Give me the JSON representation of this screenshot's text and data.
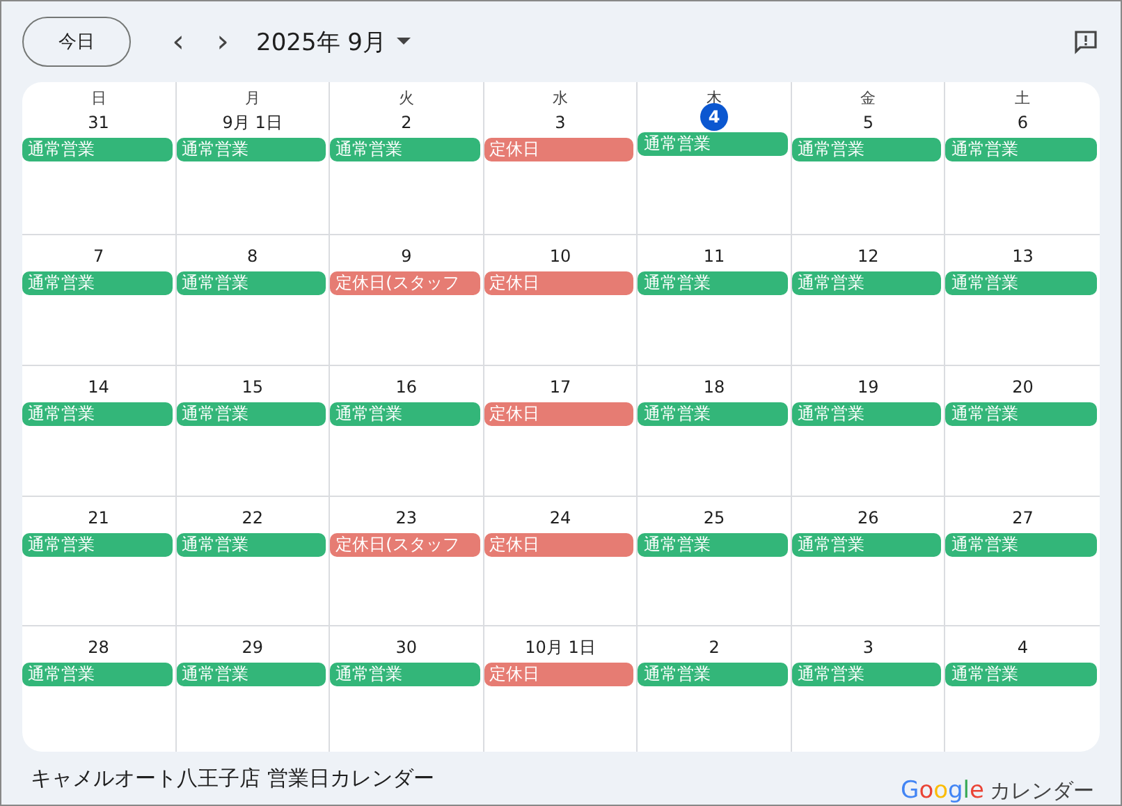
{
  "toolbar": {
    "today_button": "今日",
    "prev": "‹",
    "next": "›",
    "month": "2025年 9月"
  },
  "weekdays": [
    "日",
    "月",
    "火",
    "水",
    "木",
    "金",
    "土"
  ],
  "weeks": [
    [
      {
        "date": "31",
        "today": false,
        "event": {
          "kind": "open",
          "title": "通常営業"
        }
      },
      {
        "date": "9月 1日",
        "today": false,
        "event": {
          "kind": "open",
          "title": "通常営業"
        }
      },
      {
        "date": "2",
        "today": false,
        "event": {
          "kind": "open",
          "title": "通常営業"
        }
      },
      {
        "date": "3",
        "today": false,
        "event": {
          "kind": "closed",
          "title": "定休日"
        }
      },
      {
        "date": "4",
        "today": true,
        "event": {
          "kind": "open",
          "title": "通常営業"
        }
      },
      {
        "date": "5",
        "today": false,
        "event": {
          "kind": "open",
          "title": "通常営業"
        }
      },
      {
        "date": "6",
        "today": false,
        "event": {
          "kind": "open",
          "title": "通常営業"
        }
      }
    ],
    [
      {
        "date": "7",
        "today": false,
        "event": {
          "kind": "open",
          "title": "通常営業"
        }
      },
      {
        "date": "8",
        "today": false,
        "event": {
          "kind": "open",
          "title": "通常営業"
        }
      },
      {
        "date": "9",
        "today": false,
        "event": {
          "kind": "closed",
          "title": "定休日(スタッフ"
        }
      },
      {
        "date": "10",
        "today": false,
        "event": {
          "kind": "closed",
          "title": "定休日"
        }
      },
      {
        "date": "11",
        "today": false,
        "event": {
          "kind": "open",
          "title": "通常営業"
        }
      },
      {
        "date": "12",
        "today": false,
        "event": {
          "kind": "open",
          "title": "通常営業"
        }
      },
      {
        "date": "13",
        "today": false,
        "event": {
          "kind": "open",
          "title": "通常営業"
        }
      }
    ],
    [
      {
        "date": "14",
        "today": false,
        "event": {
          "kind": "open",
          "title": "通常営業"
        }
      },
      {
        "date": "15",
        "today": false,
        "event": {
          "kind": "open",
          "title": "通常営業"
        }
      },
      {
        "date": "16",
        "today": false,
        "event": {
          "kind": "open",
          "title": "通常営業"
        }
      },
      {
        "date": "17",
        "today": false,
        "event": {
          "kind": "closed",
          "title": "定休日"
        }
      },
      {
        "date": "18",
        "today": false,
        "event": {
          "kind": "open",
          "title": "通常営業"
        }
      },
      {
        "date": "19",
        "today": false,
        "event": {
          "kind": "open",
          "title": "通常営業"
        }
      },
      {
        "date": "20",
        "today": false,
        "event": {
          "kind": "open",
          "title": "通常営業"
        }
      }
    ],
    [
      {
        "date": "21",
        "today": false,
        "event": {
          "kind": "open",
          "title": "通常営業"
        }
      },
      {
        "date": "22",
        "today": false,
        "event": {
          "kind": "open",
          "title": "通常営業"
        }
      },
      {
        "date": "23",
        "today": false,
        "event": {
          "kind": "closed",
          "title": "定休日(スタッフ"
        }
      },
      {
        "date": "24",
        "today": false,
        "event": {
          "kind": "closed",
          "title": "定休日"
        }
      },
      {
        "date": "25",
        "today": false,
        "event": {
          "kind": "open",
          "title": "通常営業"
        }
      },
      {
        "date": "26",
        "today": false,
        "event": {
          "kind": "open",
          "title": "通常営業"
        }
      },
      {
        "date": "27",
        "today": false,
        "event": {
          "kind": "open",
          "title": "通常営業"
        }
      }
    ],
    [
      {
        "date": "28",
        "today": false,
        "event": {
          "kind": "open",
          "title": "通常営業"
        }
      },
      {
        "date": "29",
        "today": false,
        "event": {
          "kind": "open",
          "title": "通常営業"
        }
      },
      {
        "date": "30",
        "today": false,
        "event": {
          "kind": "open",
          "title": "通常営業"
        }
      },
      {
        "date": "10月 1日",
        "today": false,
        "event": {
          "kind": "closed",
          "title": "定休日"
        }
      },
      {
        "date": "2",
        "today": false,
        "event": {
          "kind": "open",
          "title": "通常営業"
        }
      },
      {
        "date": "3",
        "today": false,
        "event": {
          "kind": "open",
          "title": "通常営業"
        }
      },
      {
        "date": "4",
        "today": false,
        "event": {
          "kind": "open",
          "title": "通常営業"
        }
      }
    ]
  ],
  "footer": {
    "title": "キャメルオート八王子店 営業日カレンダー",
    "logo": "Google",
    "product": "カレンダー"
  }
}
